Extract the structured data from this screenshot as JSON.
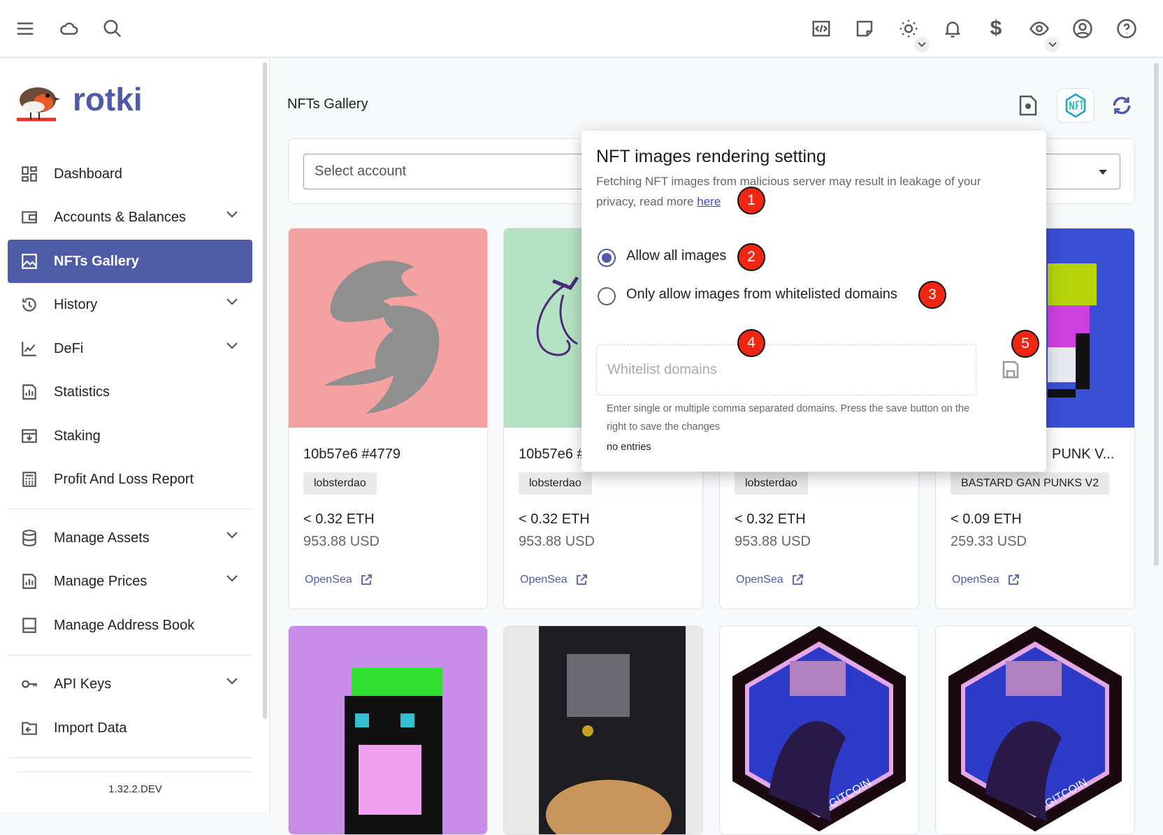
{
  "topbar": {
    "icons": [
      "menu-icon",
      "cloud-icon",
      "search-icon",
      "code-icon",
      "notes-icon",
      "theme-sun-icon",
      "bell-icon",
      "dollar-icon",
      "eye-icon",
      "account-icon",
      "help-icon"
    ]
  },
  "sidebar": {
    "brand": "rotki",
    "items": [
      {
        "label": "Dashboard",
        "icon": "dashboard-icon"
      },
      {
        "label": "Accounts & Balances",
        "icon": "wallet-icon",
        "expandable": true
      },
      {
        "label": "NFTs Gallery",
        "icon": "image-icon",
        "active": true
      },
      {
        "label": "History",
        "icon": "history-icon",
        "expandable": true
      },
      {
        "label": "DeFi",
        "icon": "chart-line-icon",
        "expandable": true
      },
      {
        "label": "Statistics",
        "icon": "statistics-icon"
      },
      {
        "label": "Staking",
        "icon": "staking-icon"
      },
      {
        "label": "Profit And Loss Report",
        "icon": "calculator-icon"
      },
      {
        "label": "Manage Assets",
        "icon": "database-icon",
        "expandable": true
      },
      {
        "label": "Manage Prices",
        "icon": "prices-icon",
        "expandable": true
      },
      {
        "label": "Manage Address Book",
        "icon": "address-book-icon"
      },
      {
        "label": "API Keys",
        "icon": "key-icon",
        "expandable": true
      },
      {
        "label": "Import Data",
        "icon": "import-icon"
      }
    ],
    "version": "1.32.2.DEV"
  },
  "main": {
    "title": "NFTs Gallery",
    "select_account_placeholder": "Select account",
    "cards": [
      {
        "title": "10b57e6 #4779",
        "collection": "lobsterdao",
        "eth": "< 0.32 ETH",
        "usd": "953.88 USD",
        "link": "OpenSea"
      },
      {
        "title": "10b57e6 #",
        "collection": "lobsterdao",
        "eth": "< 0.32 ETH",
        "usd": "953.88 USD",
        "link": "OpenSea"
      },
      {
        "title": "",
        "collection": "lobsterdao",
        "eth": "< 0.32 ETH",
        "usd": "953.88 USD",
        "link": "OpenSea"
      },
      {
        "title": "PUNK V...",
        "collection": "BASTARD GAN PUNKS V2",
        "eth": "< 0.09 ETH",
        "usd": "259.33 USD",
        "link": "OpenSea"
      }
    ],
    "second_row_text": [
      "GITCOIN",
      "GITCOIN"
    ]
  },
  "popup": {
    "title": "NFT images rendering setting",
    "description": "Fetching NFT images from malicious server may result in leakage of your privacy, read more",
    "link": "here",
    "option_all": "Allow all images",
    "option_whitelist": "Only allow images from whitelisted domains",
    "selected": "all",
    "whitelist_placeholder": "Whitelist domains",
    "hint": "Enter single or multiple comma separated domains. Press the save button on the right to save the changes",
    "empty": "no entries"
  },
  "annotations": [
    "1",
    "2",
    "3",
    "4",
    "5"
  ],
  "colors": {
    "accent": "#4e5ba6",
    "badge": "#ee2613"
  }
}
